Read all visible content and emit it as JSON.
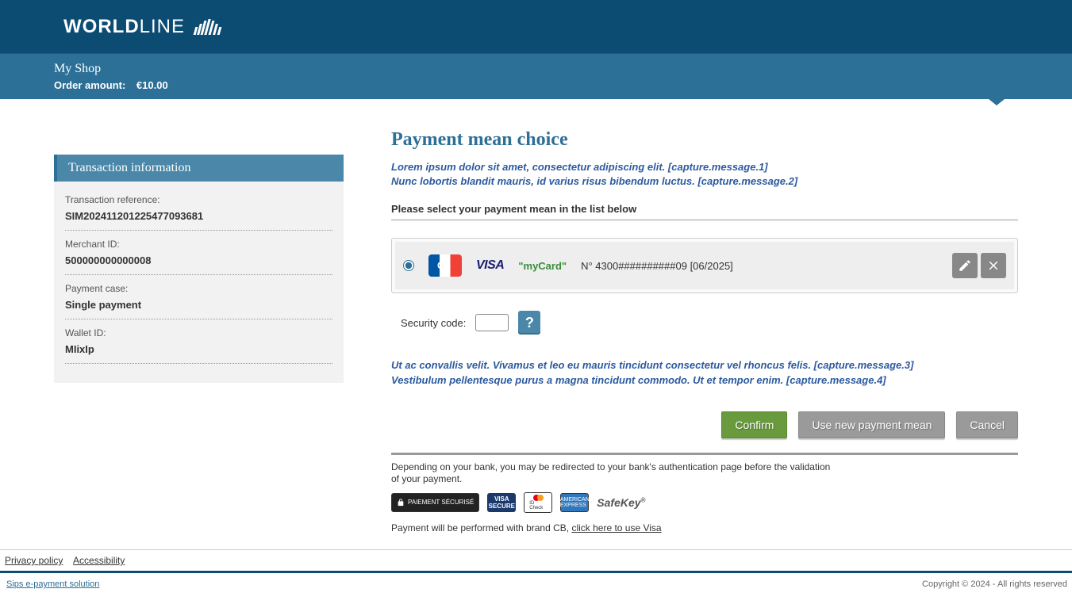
{
  "brand": {
    "name_bold": "WORLD",
    "name_light": "LINE"
  },
  "header": {
    "shop_name": "My Shop",
    "order_amount_label": "Order amount:",
    "order_amount_value": "€10.00"
  },
  "sidebar": {
    "title": "Transaction information",
    "rows": [
      {
        "label": "Transaction reference:",
        "value": "SIM202411201225477093681"
      },
      {
        "label": "Merchant ID:",
        "value": "500000000000008"
      },
      {
        "label": "Payment case:",
        "value": "Single payment"
      },
      {
        "label": "Wallet ID:",
        "value": "MIixIp"
      }
    ]
  },
  "content": {
    "title": "Payment mean choice",
    "capture_msg_1": "Lorem ipsum dolor sit amet, consectetur adipiscing elit. [capture.message.1]",
    "capture_msg_2": "Nunc lobortis blandit mauris, id varius risus bibendum luctus. [capture.message.2]",
    "select_instruction": "Please select your payment mean in the list below",
    "card": {
      "nickname": "\"myCard\"",
      "details": "N° 4300##########09 [06/2025]",
      "visa_label": "VISA"
    },
    "security_code_label": "Security code:",
    "help_label": "?",
    "capture_msg_3": "Ut ac convallis velit. Vivamus et leo eu mauris tincidunt consectetur vel rhoncus felis. [capture.message.3]",
    "capture_msg_4": "Vestibulum pellentesque purus a magna tincidunt commodo. Ut et tempor enim. [capture.message.4]",
    "buttons": {
      "confirm": "Confirm",
      "new_payment": "Use new payment mean",
      "cancel": "Cancel"
    },
    "bank_note": "Depending on your bank, you may be redirected to your bank's authentication page before the validation of your payment.",
    "badges": {
      "secure_text": "PAIEMENT SÉCURISÉ",
      "visa_secure": "VISA SECURE",
      "mc_check": "ID Check",
      "amex": "AMERICAN EXPRESS",
      "safekey": "SafeKey"
    },
    "brand_note_prefix": "Payment will be performed with brand CB, ",
    "brand_note_link": "click here to use Visa"
  },
  "footer": {
    "privacy": "Privacy policy",
    "accessibility": "Accessibility",
    "sips": "Sips e-payment solution",
    "copyright": "Copyright © 2024 - All rights reserved"
  }
}
